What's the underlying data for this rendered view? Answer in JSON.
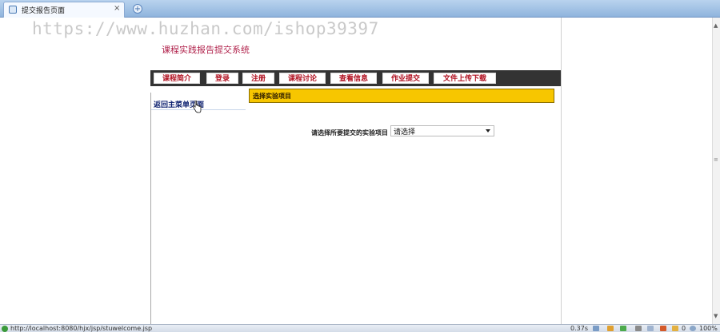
{
  "browser": {
    "tab_title": "提交报告页面",
    "tab_close": "×",
    "new_tab": "+"
  },
  "watermark": "https://www.huzhan.com/ishop39397",
  "page": {
    "system_title": "课程实践报告提交系统",
    "nav": [
      {
        "label": "课程简介"
      },
      {
        "label": "登录"
      },
      {
        "label": "注册"
      },
      {
        "label": "课程讨论"
      },
      {
        "label": "查看信息"
      },
      {
        "label": "作业提交"
      },
      {
        "label": "文件上传下载"
      }
    ],
    "sidebar": {
      "back_link": "返回主菜单页面"
    },
    "panel_title": "选择实验项目",
    "form": {
      "label": "请选择所要提交的实验项目",
      "select_value": "请选择"
    }
  },
  "statusbar": {
    "url": "http://localhost:8080/hjx/jsp/stuwelcome.jsp",
    "load_time": "0.37s",
    "count": "0",
    "zoom": "100%"
  },
  "colors": {
    "nav_bg": "#333333",
    "nav_text": "#b01020",
    "panel_bg": "#f7c600",
    "title": "#b0204a",
    "link": "#0a1e6e"
  },
  "icons": [
    "page-icon",
    "close-icon",
    "new-tab-icon",
    "hand-cursor-icon",
    "dropdown-arrow-icon",
    "security-ok-icon"
  ]
}
